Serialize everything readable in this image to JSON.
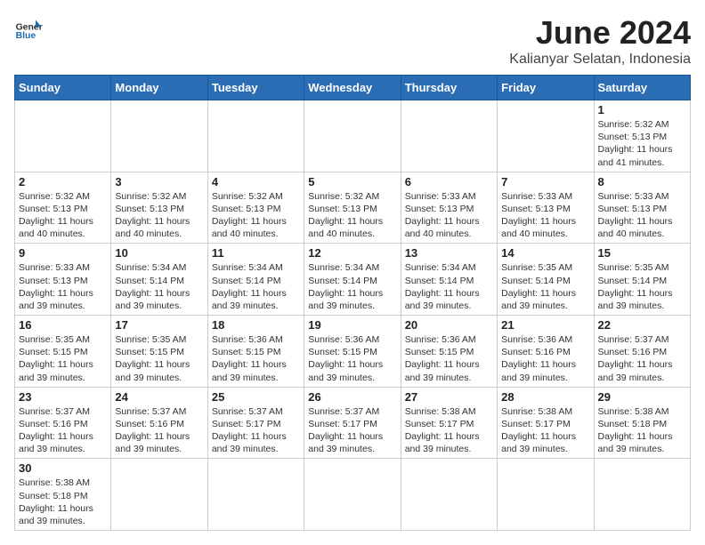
{
  "header": {
    "logo_general": "General",
    "logo_blue": "Blue",
    "title": "June 2024",
    "location": "Kalianyar Selatan, Indonesia"
  },
  "days_of_week": [
    "Sunday",
    "Monday",
    "Tuesday",
    "Wednesday",
    "Thursday",
    "Friday",
    "Saturday"
  ],
  "weeks": [
    [
      {
        "day": "",
        "info": ""
      },
      {
        "day": "",
        "info": ""
      },
      {
        "day": "",
        "info": ""
      },
      {
        "day": "",
        "info": ""
      },
      {
        "day": "",
        "info": ""
      },
      {
        "day": "",
        "info": ""
      },
      {
        "day": "1",
        "sunrise": "5:32 AM",
        "sunset": "5:13 PM",
        "daylight": "11 hours and 41 minutes."
      }
    ],
    [
      {
        "day": "2",
        "sunrise": "5:32 AM",
        "sunset": "5:13 PM",
        "daylight": "11 hours and 40 minutes."
      },
      {
        "day": "3",
        "sunrise": "5:32 AM",
        "sunset": "5:13 PM",
        "daylight": "11 hours and 40 minutes."
      },
      {
        "day": "4",
        "sunrise": "5:32 AM",
        "sunset": "5:13 PM",
        "daylight": "11 hours and 40 minutes."
      },
      {
        "day": "5",
        "sunrise": "5:32 AM",
        "sunset": "5:13 PM",
        "daylight": "11 hours and 40 minutes."
      },
      {
        "day": "6",
        "sunrise": "5:33 AM",
        "sunset": "5:13 PM",
        "daylight": "11 hours and 40 minutes."
      },
      {
        "day": "7",
        "sunrise": "5:33 AM",
        "sunset": "5:13 PM",
        "daylight": "11 hours and 40 minutes."
      },
      {
        "day": "8",
        "sunrise": "5:33 AM",
        "sunset": "5:13 PM",
        "daylight": "11 hours and 40 minutes."
      }
    ],
    [
      {
        "day": "9",
        "sunrise": "5:33 AM",
        "sunset": "5:13 PM",
        "daylight": "11 hours and 39 minutes."
      },
      {
        "day": "10",
        "sunrise": "5:34 AM",
        "sunset": "5:14 PM",
        "daylight": "11 hours and 39 minutes."
      },
      {
        "day": "11",
        "sunrise": "5:34 AM",
        "sunset": "5:14 PM",
        "daylight": "11 hours and 39 minutes."
      },
      {
        "day": "12",
        "sunrise": "5:34 AM",
        "sunset": "5:14 PM",
        "daylight": "11 hours and 39 minutes."
      },
      {
        "day": "13",
        "sunrise": "5:34 AM",
        "sunset": "5:14 PM",
        "daylight": "11 hours and 39 minutes."
      },
      {
        "day": "14",
        "sunrise": "5:35 AM",
        "sunset": "5:14 PM",
        "daylight": "11 hours and 39 minutes."
      },
      {
        "day": "15",
        "sunrise": "5:35 AM",
        "sunset": "5:14 PM",
        "daylight": "11 hours and 39 minutes."
      }
    ],
    [
      {
        "day": "16",
        "sunrise": "5:35 AM",
        "sunset": "5:15 PM",
        "daylight": "11 hours and 39 minutes."
      },
      {
        "day": "17",
        "sunrise": "5:35 AM",
        "sunset": "5:15 PM",
        "daylight": "11 hours and 39 minutes."
      },
      {
        "day": "18",
        "sunrise": "5:36 AM",
        "sunset": "5:15 PM",
        "daylight": "11 hours and 39 minutes."
      },
      {
        "day": "19",
        "sunrise": "5:36 AM",
        "sunset": "5:15 PM",
        "daylight": "11 hours and 39 minutes."
      },
      {
        "day": "20",
        "sunrise": "5:36 AM",
        "sunset": "5:15 PM",
        "daylight": "11 hours and 39 minutes."
      },
      {
        "day": "21",
        "sunrise": "5:36 AM",
        "sunset": "5:16 PM",
        "daylight": "11 hours and 39 minutes."
      },
      {
        "day": "22",
        "sunrise": "5:37 AM",
        "sunset": "5:16 PM",
        "daylight": "11 hours and 39 minutes."
      }
    ],
    [
      {
        "day": "23",
        "sunrise": "5:37 AM",
        "sunset": "5:16 PM",
        "daylight": "11 hours and 39 minutes."
      },
      {
        "day": "24",
        "sunrise": "5:37 AM",
        "sunset": "5:16 PM",
        "daylight": "11 hours and 39 minutes."
      },
      {
        "day": "25",
        "sunrise": "5:37 AM",
        "sunset": "5:17 PM",
        "daylight": "11 hours and 39 minutes."
      },
      {
        "day": "26",
        "sunrise": "5:37 AM",
        "sunset": "5:17 PM",
        "daylight": "11 hours and 39 minutes."
      },
      {
        "day": "27",
        "sunrise": "5:38 AM",
        "sunset": "5:17 PM",
        "daylight": "11 hours and 39 minutes."
      },
      {
        "day": "28",
        "sunrise": "5:38 AM",
        "sunset": "5:17 PM",
        "daylight": "11 hours and 39 minutes."
      },
      {
        "day": "29",
        "sunrise": "5:38 AM",
        "sunset": "5:18 PM",
        "daylight": "11 hours and 39 minutes."
      }
    ],
    [
      {
        "day": "30",
        "sunrise": "5:38 AM",
        "sunset": "5:18 PM",
        "daylight": "11 hours and 39 minutes."
      },
      {
        "day": "",
        "info": ""
      },
      {
        "day": "",
        "info": ""
      },
      {
        "day": "",
        "info": ""
      },
      {
        "day": "",
        "info": ""
      },
      {
        "day": "",
        "info": ""
      },
      {
        "day": "",
        "info": ""
      }
    ]
  ]
}
